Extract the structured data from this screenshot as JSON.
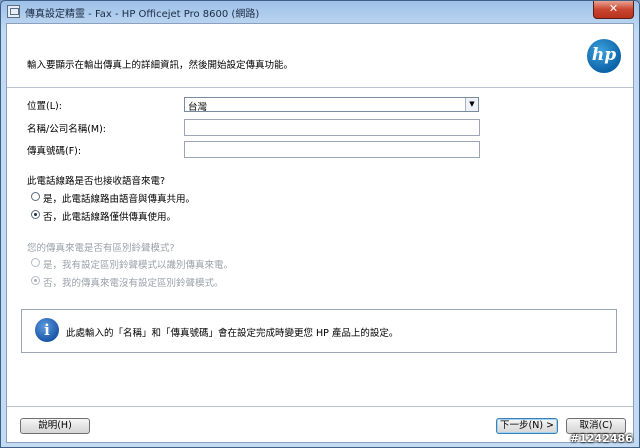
{
  "window": {
    "title": "傳真設定精靈 - Fax - HP Officejet Pro 8600 (網路)",
    "close_glyph": "✕"
  },
  "header": {
    "instruction": "輸入要顯示在輸出傳真上的詳細資訊，然後開始設定傳真功能。",
    "logo_text": "hp"
  },
  "form": {
    "location_label": "位置(L):",
    "location_value": "台灣",
    "name_label": "名稱/公司名稱(M):",
    "name_value": "",
    "fax_number_label": "傳真號碼(F):",
    "fax_number_value": ""
  },
  "voice_question": {
    "label": "此電話線路是否也接收語音來電?",
    "options": [
      {
        "label": "是，此電話線路由語音與傳真共用。",
        "checked": false
      },
      {
        "label": "否，此電話線路僅供傳真使用。",
        "checked": true
      }
    ]
  },
  "ring_question": {
    "label": "您的傳真來電是否有區別鈴聲模式?",
    "disabled": true,
    "options": [
      {
        "label": "是，我有設定區別鈴聲模式以識別傳真來電。",
        "checked": false
      },
      {
        "label": "否，我的傳真來電沒有設定區別鈴聲模式。",
        "checked": true
      }
    ]
  },
  "info": {
    "icon": "info-icon",
    "icon_glyph": "i",
    "text": "此處輸入的「名稱」和「傳真號碼」會在設定完成時變更您 HP 產品上的設定。"
  },
  "buttons": {
    "help": "說明(H)",
    "next": "下一步(N) >",
    "cancel": "取消(C)"
  },
  "watermark": "#1242486"
}
